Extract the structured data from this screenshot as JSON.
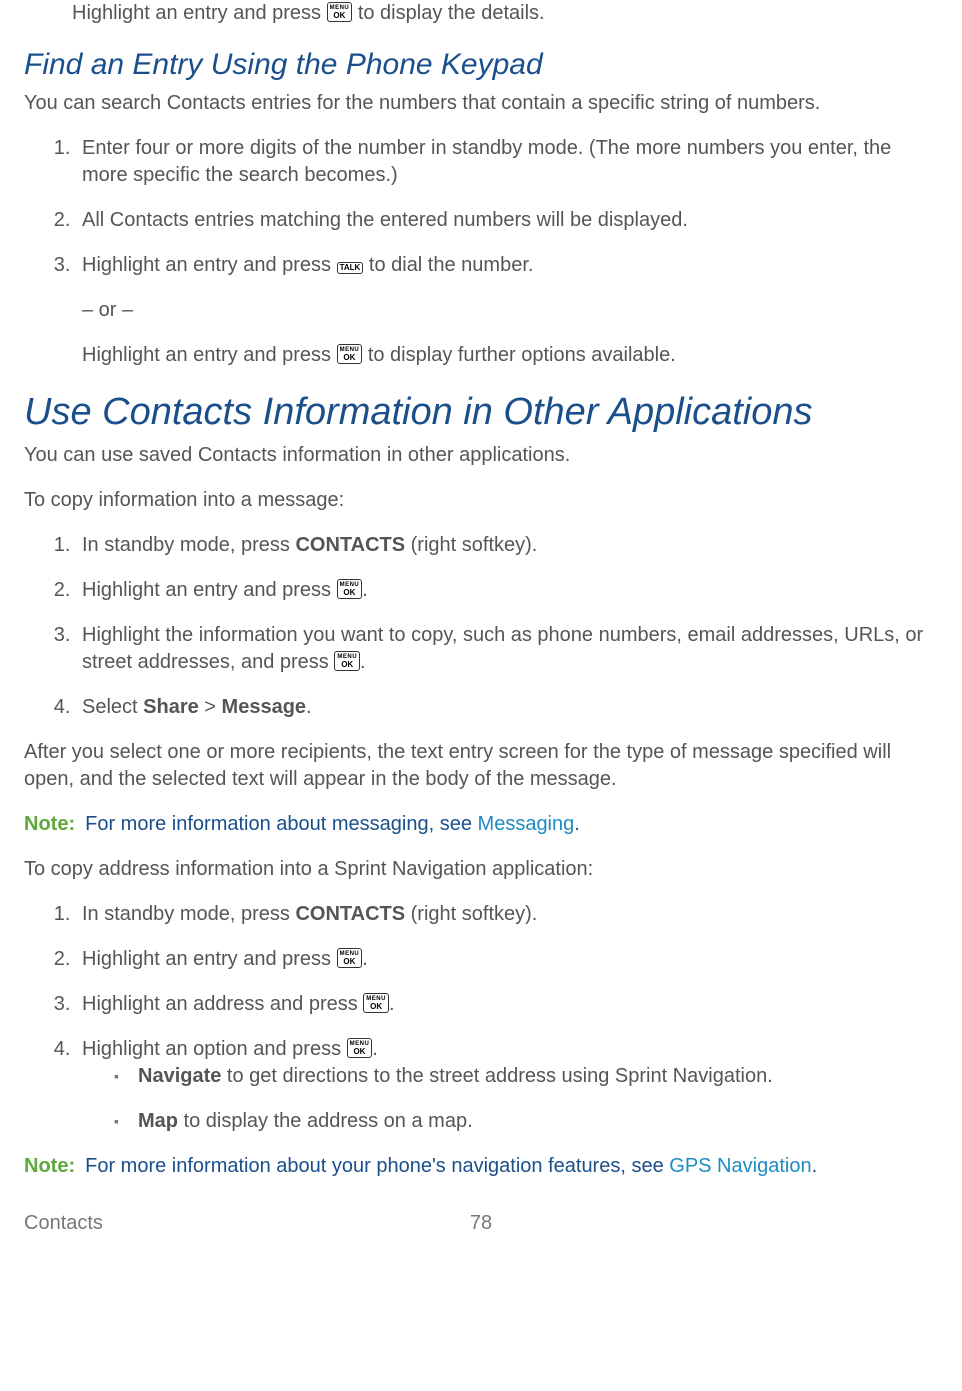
{
  "intro": {
    "before": "Highlight an entry and press ",
    "key": "MENU/OK",
    "after": " to display the details."
  },
  "sec1": {
    "heading": "Find an Entry Using the Phone Keypad",
    "lead": "You can search Contacts entries for the numbers that contain a specific string of numbers.",
    "items": {
      "i1": "Enter four or more digits of the number in standby mode. (The more numbers you enter, the more specific the search becomes.)",
      "i2": "All Contacts entries matching the entered numbers will be displayed.",
      "i3_before": " Highlight an entry and press ",
      "i3_key": "TALK",
      "i3_after": " to dial the number.",
      "or": "– or –",
      "i3b_before": "Highlight an entry and press ",
      "i3b_key": "MENU/OK",
      "i3b_after": " to display further options available."
    }
  },
  "sec2": {
    "heading": "Use Contacts Information in Other Applications",
    "lead": "You can use saved Contacts information in other applications.",
    "sub1": "To copy information into a message:",
    "listA": {
      "a1_before": "In standby mode, press ",
      "a1_bold": "CONTACTS",
      "a1_after": " (right softkey).",
      "a2_before": "Highlight an entry and press ",
      "a2_after": ".",
      "a3_before": "Highlight the information you want to copy, such as phone numbers, email addresses, URLs, or street addresses, and press ",
      "a3_after": ".",
      "a4_before": "Select ",
      "a4_bold1": "Share",
      "a4_mid": " > ",
      "a4_bold2": "Message",
      "a4_after": "."
    },
    "after1": "After you select one or more recipients, the text entry screen for the type of message specified will open, and the selected text will appear in the body of the message.",
    "note1": {
      "label": "Note:",
      "text": "For more information about messaging, see ",
      "link": "Messaging",
      "dot": "."
    },
    "sub2": "To copy address information into a Sprint Navigation application:",
    "listB": {
      "b1_before": "In standby mode, press ",
      "b1_bold": "CONTACTS",
      "b1_after": " (right softkey).",
      "b2_before": "Highlight an entry and press ",
      "b2_after": ".",
      "b3_before": "Highlight an address and press ",
      "b3_after": ".",
      "b4_before": "Highlight an option and press ",
      "b4_after": ".",
      "bullets": {
        "nav_bold": "Navigate",
        "nav_rest": " to get directions to the street address using Sprint Navigation.",
        "map_bold": "Map",
        "map_rest": " to display the address on a map."
      }
    },
    "note2": {
      "label": "Note:",
      "text": "For more information about your phone's navigation features, see ",
      "link": "GPS Navigation",
      "dot": "."
    }
  },
  "footer": {
    "left": "Contacts",
    "page": "78"
  },
  "keys": {
    "menuok_top": "MENU",
    "menuok_bot": "OK",
    "talk": "TALK"
  }
}
